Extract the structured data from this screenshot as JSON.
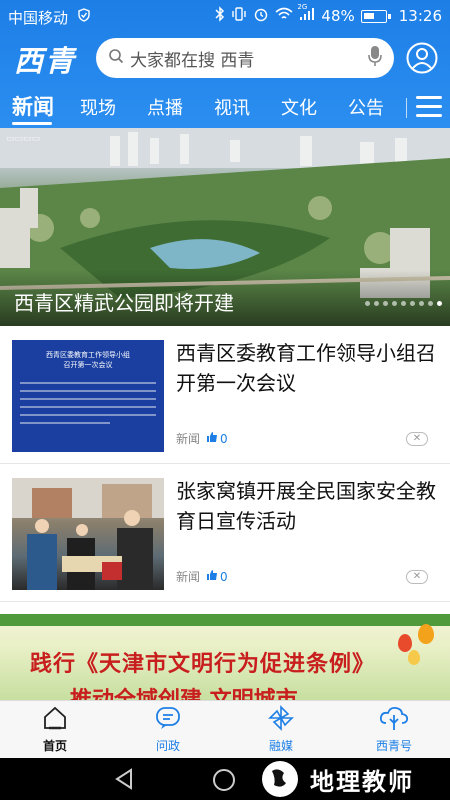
{
  "status_bar": {
    "carrier": "中国移动",
    "network": "2G",
    "battery": "48%",
    "time": "13:26"
  },
  "header": {
    "logo": "西青",
    "search_placeholder": "大家都在搜 西青"
  },
  "tabs": [
    {
      "label": "新闻",
      "active": true
    },
    {
      "label": "现场"
    },
    {
      "label": "点播"
    },
    {
      "label": "视讯"
    },
    {
      "label": "文化"
    },
    {
      "label": "公告"
    }
  ],
  "hero": {
    "caption": "西青区精武公园即将开建",
    "slides_total": 9,
    "slides_active_index": 8
  },
  "news": [
    {
      "title": "西青区委教育工作领导小组召开第一次会议",
      "category": "新闻",
      "likes": "0",
      "thumb_heading": "西青区委教育工作领导小组\n召开第一次会议"
    },
    {
      "title": "张家窝镇开展全民国家安全教育日宣传活动",
      "category": "新闻",
      "likes": "0"
    }
  ],
  "promo": {
    "line1": "践行《天津市文明行为促进条例》",
    "line2": "推动全域创建 文明城市"
  },
  "bottom_nav": [
    {
      "label": "首页",
      "icon": "home-icon",
      "active": true
    },
    {
      "label": "问政",
      "icon": "chat-icon"
    },
    {
      "label": "融媒",
      "icon": "pinwheel-icon"
    },
    {
      "label": "西青号",
      "icon": "cloud-tree-icon"
    }
  ],
  "watermark": "地理教师",
  "colors": {
    "brand_blue": "#1d7fe6",
    "headline_red": "#c81e1e"
  }
}
